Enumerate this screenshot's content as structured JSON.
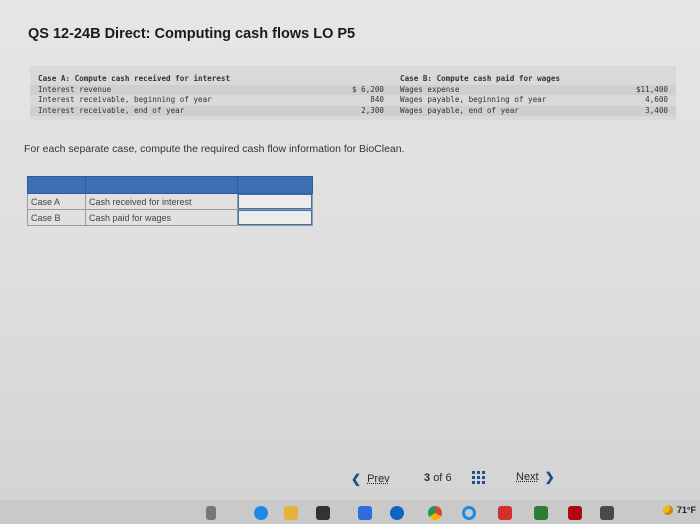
{
  "title": "QS 12-24B Direct: Computing cash flows LO P5",
  "case_a": {
    "heading": "Case A: Compute cash received for interest",
    "rows": [
      {
        "label": "Interest revenue",
        "value": "$ 6,200"
      },
      {
        "label": "Interest receivable, beginning of year",
        "value": "840"
      },
      {
        "label": "Interest receivable, end of year",
        "value": "2,300"
      }
    ]
  },
  "case_b": {
    "heading": "Case B: Compute cash paid for wages",
    "rows": [
      {
        "label": "Wages expense",
        "value": "$11,400"
      },
      {
        "label": "Wages payable, beginning of year",
        "value": "4,600"
      },
      {
        "label": "Wages payable, end of year",
        "value": "3,400"
      }
    ]
  },
  "instruction": "For each separate case, compute the required cash flow information for BioClean.",
  "answer_table": {
    "rows": [
      {
        "case": "Case A",
        "description": "Cash received for interest",
        "value": ""
      },
      {
        "case": "Case B",
        "description": "Cash paid for wages",
        "value": ""
      }
    ]
  },
  "nav": {
    "prev_label": "Prev",
    "current_page": "3",
    "of_label": "of",
    "total_pages": "6",
    "next_label": "Next"
  },
  "taskbar": {
    "weather": "71°F"
  },
  "colors": {
    "accent": "#3d6fb3",
    "nav_blue": "#1f4e8c"
  }
}
